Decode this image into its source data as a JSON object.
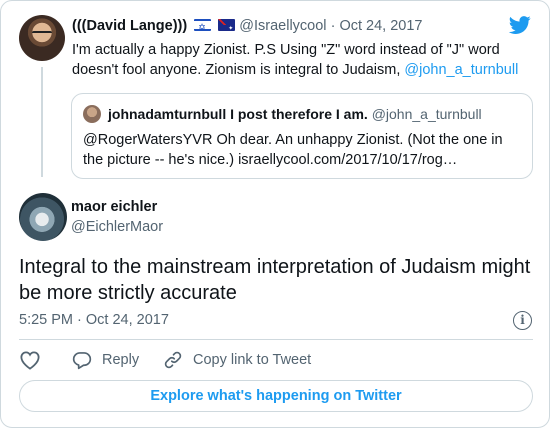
{
  "parent": {
    "name": "(((David Lange)))",
    "handle": "@Israellycool",
    "separator": "·",
    "date": "Oct 24, 2017",
    "text_before_link": "I'm actually a happy Zionist. P.S Using \"Z\" word instead of \"J\" word doesn't fool anyone. Zionism is integral to Judaism, ",
    "mention": "@john_a_turnbull"
  },
  "quote": {
    "name": "johnadamturnbull I post therefore I am.",
    "handle": "@john_a_turnbull",
    "text": "@RogerWatersYVR  Oh dear. An unhappy Zionist. (Not the one in the picture -- he's nice.) israellycool.com/2017/10/17/rog…"
  },
  "reply": {
    "name": "maor eichler",
    "handle": "@EichlerMaor",
    "text": "Integral to the mainstream interpretation of Judaism might be more strictly accurate",
    "time": "5:25 PM",
    "separator": "·",
    "date": "Oct 24, 2017",
    "info_symbol": "i"
  },
  "actions": {
    "reply_label": "Reply",
    "copy_label": "Copy link to Tweet"
  },
  "explore_label": "Explore what's happening on Twitter",
  "colors": {
    "accent": "#1d9bf0",
    "secondary_text": "#536471",
    "border": "#cfd9de"
  },
  "icons": [
    "twitter-bird-icon",
    "israel-flag-icon",
    "australia-flag-icon",
    "heart-icon",
    "reply-icon",
    "link-icon",
    "info-icon"
  ]
}
